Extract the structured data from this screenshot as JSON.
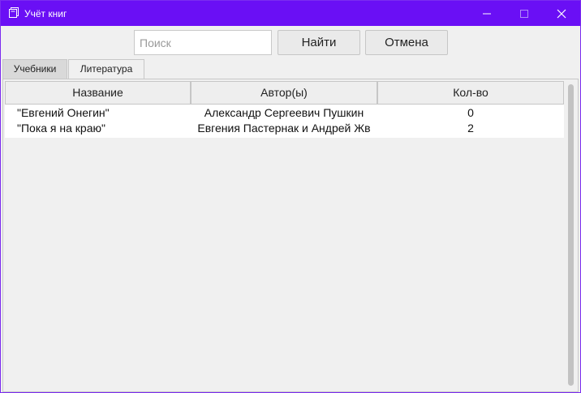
{
  "window": {
    "title": "Учёт книг",
    "icon": "book-stack-icon",
    "accent_color": "#6a0ff5",
    "controls": [
      "minimize-icon",
      "maximize-icon",
      "close-icon"
    ]
  },
  "toolbar": {
    "search_placeholder": "Поиск",
    "search_value": "",
    "find_label": "Найти",
    "cancel_label": "Отмена"
  },
  "tabs": [
    {
      "label": "Учебники",
      "selected": true
    },
    {
      "label": "Литература",
      "selected": false
    }
  ],
  "table": {
    "columns": [
      "Название",
      "Автор(ы)",
      "Кол-во"
    ],
    "rows": [
      {
        "title": "\"Евгений Онегин\"",
        "author": "Александр Сергеевич Пушкин",
        "count": "0"
      },
      {
        "title": "\"Пока я на краю\"",
        "author": "Евгения Пастернак и Андрей Жв",
        "count": "2"
      }
    ]
  }
}
